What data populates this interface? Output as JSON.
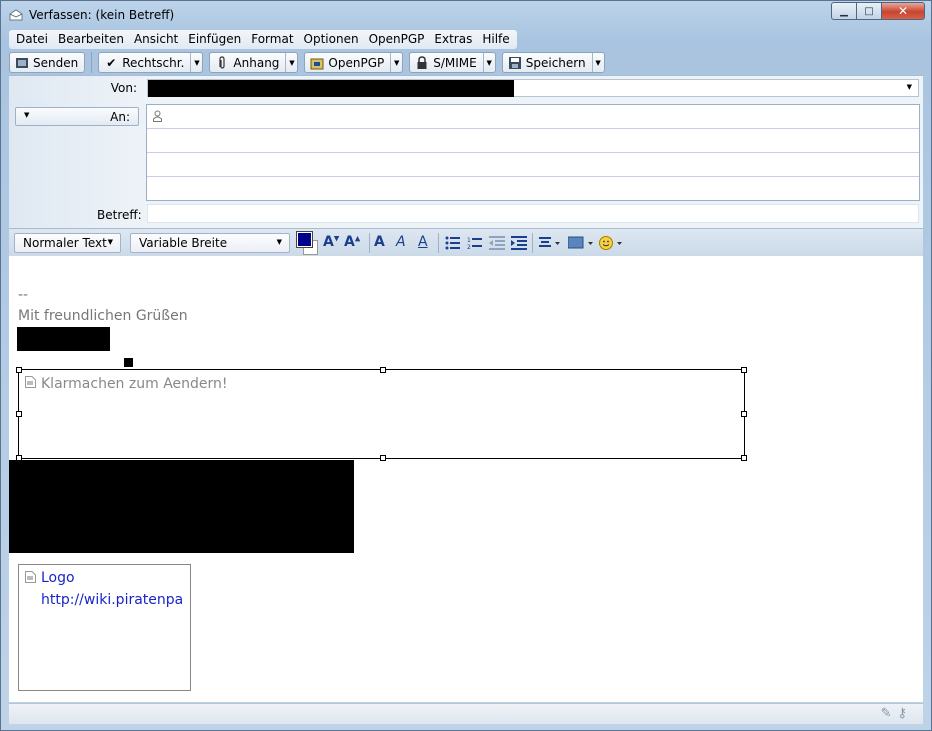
{
  "window": {
    "title": "Verfassen: (kein Betreff)",
    "controls": {
      "minimize": "▁",
      "maximize": "□",
      "close": "✕"
    }
  },
  "menubar": {
    "items": [
      "Datei",
      "Bearbeiten",
      "Ansicht",
      "Einfügen",
      "Format",
      "Optionen",
      "OpenPGP",
      "Extras",
      "Hilfe"
    ]
  },
  "toolbar": {
    "send": "Senden",
    "spell": "Rechtschr.",
    "attach": "Anhang",
    "openpgp": "OpenPGP",
    "smime": "S/MIME",
    "save": "Speichern"
  },
  "header": {
    "from_label": "Von:",
    "to_label": "An:",
    "subject_label": "Betreff:",
    "subject_value": ""
  },
  "format_bar": {
    "paragraph_style": "Normaler Text",
    "font": "Variable Breite"
  },
  "editor": {
    "sig_separator": "--",
    "sig_greeting": "Mit freundlichen Grüßen",
    "image_alt": "Klarmachen zum Aendern!",
    "logo_alt": "Logo",
    "logo_url": "http://wiki.piratenpa"
  },
  "colors": {
    "text_color": "#00008b",
    "link": "#1a25c8",
    "signature_gray": "#777777"
  }
}
